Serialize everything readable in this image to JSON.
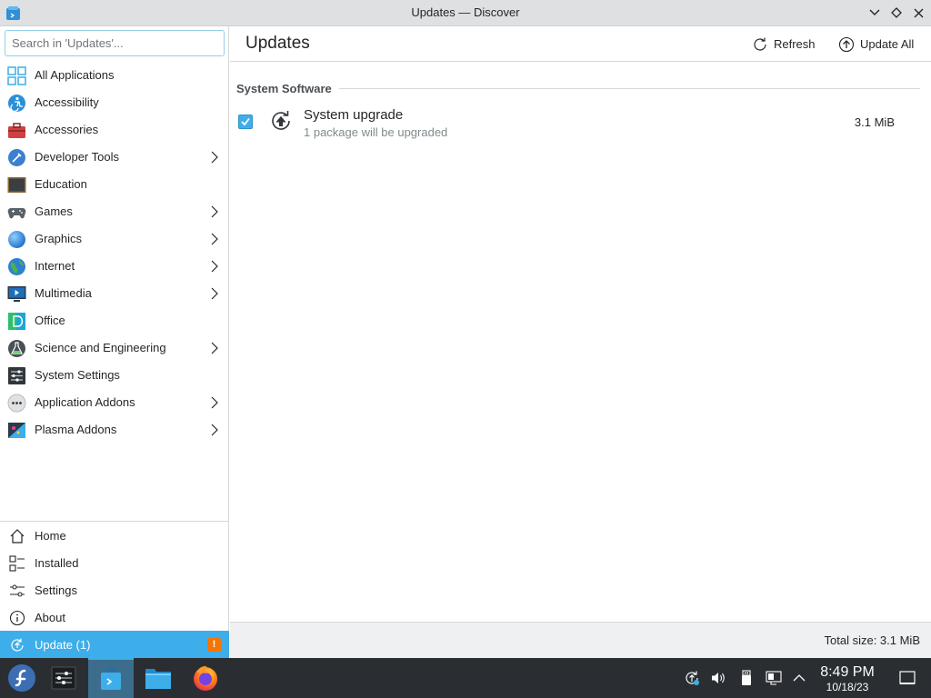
{
  "window": {
    "title": "Updates — Discover"
  },
  "search": {
    "placeholder": "Search in 'Updates'..."
  },
  "categories": [
    {
      "label": "All Applications",
      "icon": "grid-icon",
      "has_submenu": false
    },
    {
      "label": "Accessibility",
      "icon": "accessibility-icon",
      "has_submenu": false
    },
    {
      "label": "Accessories",
      "icon": "toolbox-icon",
      "has_submenu": false
    },
    {
      "label": "Developer Tools",
      "icon": "developer-tools-icon",
      "has_submenu": true
    },
    {
      "label": "Education",
      "icon": "chalkboard-icon",
      "has_submenu": false
    },
    {
      "label": "Games",
      "icon": "gamepad-icon",
      "has_submenu": true
    },
    {
      "label": "Graphics",
      "icon": "graphics-sphere-icon",
      "has_submenu": true
    },
    {
      "label": "Internet",
      "icon": "globe-icon",
      "has_submenu": true
    },
    {
      "label": "Multimedia",
      "icon": "multimedia-icon",
      "has_submenu": true
    },
    {
      "label": "Office",
      "icon": "office-icon",
      "has_submenu": false
    },
    {
      "label": "Science and Engineering",
      "icon": "flask-icon",
      "has_submenu": true
    },
    {
      "label": "System Settings",
      "icon": "system-settings-icon",
      "has_submenu": false
    },
    {
      "label": "Application Addons",
      "icon": "addons-dots-icon",
      "has_submenu": true
    },
    {
      "label": "Plasma Addons",
      "icon": "plasma-addons-icon",
      "has_submenu": true
    }
  ],
  "bottom_nav": {
    "home": "Home",
    "installed": "Installed",
    "settings": "Settings",
    "about": "About",
    "update": "Update (1)",
    "update_badge": "!"
  },
  "header": {
    "page_title": "Updates",
    "refresh_label": "Refresh",
    "update_all_label": "Update All"
  },
  "updates": {
    "section_title": "System Software",
    "items": [
      {
        "name": "System upgrade",
        "description": "1 package will be upgraded",
        "size": "3.1 MiB",
        "checked": true
      }
    ]
  },
  "footer": {
    "total_size": "Total size: 3.1 MiB"
  },
  "taskbar": {
    "time": "8:49 PM",
    "date": "10/18/23"
  },
  "colors": {
    "accent": "#3daee9",
    "warning": "#f67400",
    "taskbar": "#2a2e32",
    "titlebar": "#dee0e2"
  }
}
